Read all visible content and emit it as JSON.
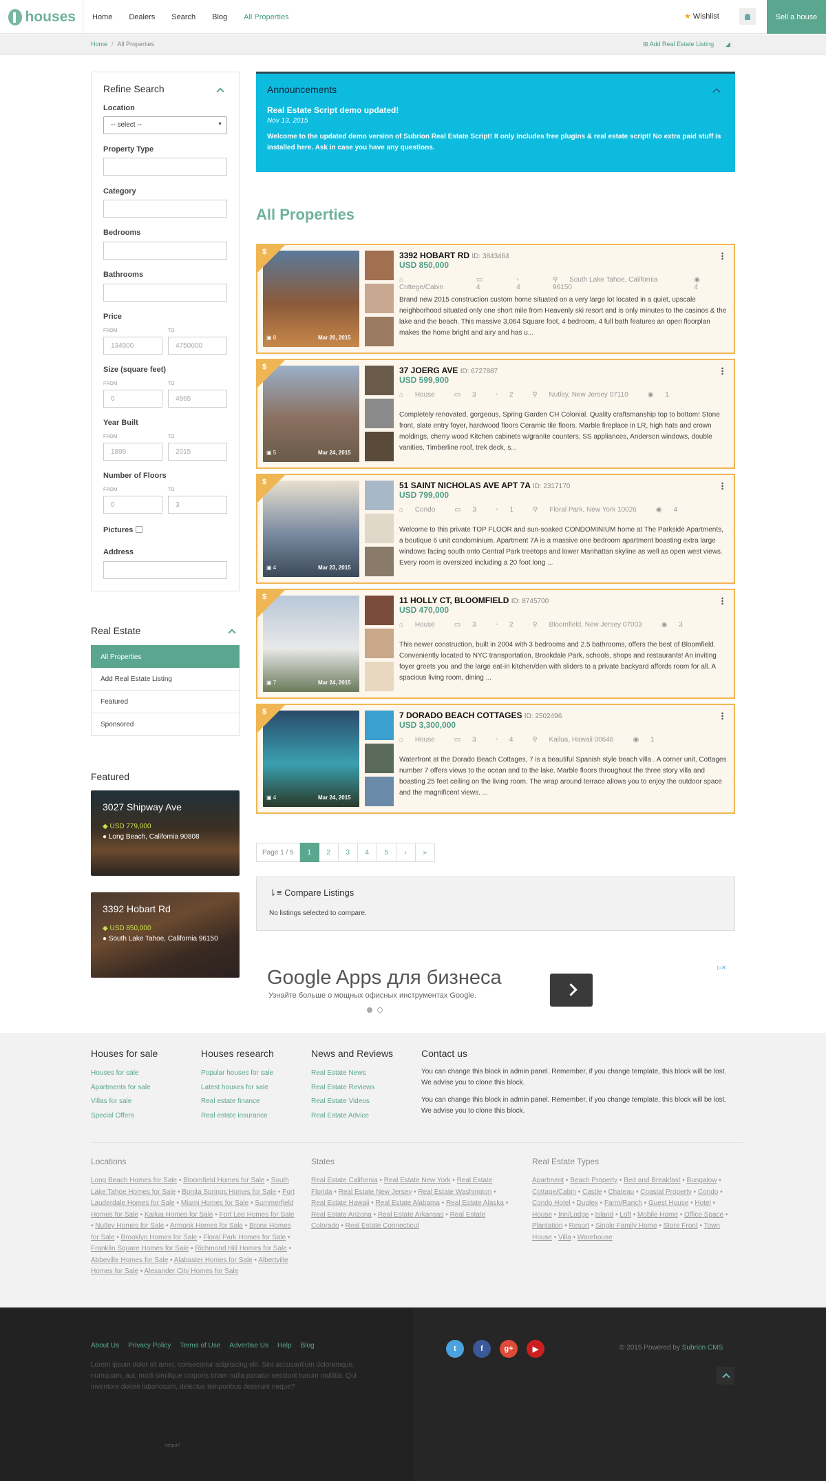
{
  "header": {
    "logo_text": "houses",
    "nav": [
      "Home",
      "Dealers",
      "Search",
      "Blog",
      "All Properties"
    ],
    "wishlist": "Wishlist",
    "sell": "Sell a house"
  },
  "breadcrumb": {
    "home": "Home",
    "sep": "/",
    "current": "All Properties",
    "add_listing": "Add Real Estate Listing"
  },
  "refine": {
    "title": "Refine Search",
    "location_label": "Location",
    "location_value": "-- select --",
    "property_type": "Property Type",
    "category": "Category",
    "bedrooms": "Bedrooms",
    "bathrooms": "Bathrooms",
    "from": "FROM",
    "to": "TO",
    "price": {
      "label": "Price",
      "from": "134900",
      "to": "4750000"
    },
    "size": {
      "label": "Size (square feet)",
      "from": "0",
      "to": "4865"
    },
    "year": {
      "label": "Year Built",
      "from": "1899",
      "to": "2015"
    },
    "floors": {
      "label": "Number of Floors",
      "from": "0",
      "to": "3"
    },
    "pictures": "Pictures",
    "address": "Address"
  },
  "real_estate": {
    "title": "Real Estate",
    "items": [
      "All Properties",
      "Add Real Estate Listing",
      "Featured",
      "Sponsored"
    ]
  },
  "featured": {
    "title": "Featured",
    "cards": [
      {
        "title": "3027 Shipway Ave",
        "price": "USD 779,000",
        "address": "Long Beach, California 90808"
      },
      {
        "title": "3392 Hobart Rd",
        "price": "USD 850,000",
        "address": "South Lake Tahoe, California 96150"
      }
    ]
  },
  "announcements": {
    "title": "Announcements",
    "subtitle": "Real Estate Script demo updated!",
    "date": "Nov 13, 2015",
    "body": "Welcome to the updated demo version of Subrion Real Estate Script! It only includes free plugins & real estate script! No extra paid stuff is installed here. Ask in case you have any questions."
  },
  "page_title": "All Properties",
  "listings": [
    {
      "title": "3392 HOBART RD",
      "id": "ID: 3843464",
      "price": "USD 850,000",
      "type": "Cottege/Cabin",
      "beds": "4",
      "baths": "4",
      "location": "South Lake Tahoe, California 96150",
      "views": "4",
      "photos": "8",
      "date": "Mar 20, 2015",
      "desc": "Brand new 2015 construction custom home situated on a very large lot located in a quiet, upscale neighborhood situated only one short mile from Heavenly ski resort and is only minutes to the casinos & the lake and the beach. This massive 3,064 Square foot, 4 bedroom, 4 full bath features an open floorplan makes the home bright and airy and has u..."
    },
    {
      "title": "37 JOERG AVE",
      "id": "ID: 6727887",
      "price": "USD 599,900",
      "type": "House",
      "beds": "3",
      "baths": "2",
      "location": "Nutley, New Jersey 07110",
      "views": "1",
      "photos": "5",
      "date": "Mar 24, 2015",
      "desc": "Completely renovated, gorgeous, Spring Garden CH Colonial. Quality craftsmanship top to bottom! Stone front, slate entry foyer, hardwood floors Ceramic tile floors. Marble fireplace in LR, high hats and crown moldings, cherry wood Kitchen cabinets w/granite counters, SS appliances, Anderson windows, double vanities, Timberline roof, trek deck, s..."
    },
    {
      "title": "51 SAINT NICHOLAS AVE APT 7A",
      "id": "ID: 2317170",
      "price": "USD 799,000",
      "type": "Condo",
      "beds": "3",
      "baths": "1",
      "location": "Floral Park, New York 10026",
      "views": "4",
      "photos": "4",
      "date": "Mar 23, 2015",
      "desc": "Welcome to this private TOP FLOOR and sun-soaked CONDOMINIUM home at The Parkside Apartments, a boutique 6 unit condominium. Apartment 7A is a massive one bedroom apartment boasting extra large windows facing south onto Central Park treetops and lower Manhattan skyline as well as open west views. Every room is oversized including a 20 foot long ..."
    },
    {
      "title": "11 HOLLY CT, BLOOMFIELD",
      "id": "ID: 8745700",
      "price": "USD 470,000",
      "type": "House",
      "beds": "3",
      "baths": "2",
      "location": "Bloomfield, New Jersey 07003",
      "views": "3",
      "photos": "7",
      "date": "Mar 24, 2015",
      "desc": "This newer construction, built in 2004 with 3 bedrooms and 2.5 bathrooms, offers the best of Bloomfield. Conveniently located to NYC transportation, Brookdale Park, schools, shops and restaurants! An inviting foyer greets you and the large eat-in kitchen/den with sliders to a private backyard affords room for all. A spacious living room, dining ..."
    },
    {
      "title": "7 DORADO BEACH COTTAGES",
      "id": "ID: 2502496",
      "price": "USD 3,300,000",
      "type": "House",
      "beds": "3",
      "baths": "4",
      "location": "Kailua, Hawaii 00646",
      "views": "1",
      "photos": "4",
      "date": "Mar 24, 2015",
      "desc": "Waterfront at the Dorado Beach Cottages, 7 is a beautiful Spanish style beach villa . A corner unit, Cottages number 7 offers views to the ocean and to the lake. Marble floors throughout the three story villa and boasting 25 feet ceiling on the living room. The wrap around terrace allows you to enjoy the outdoor space and the magnificent views. ..."
    }
  ],
  "pagination": {
    "info": "Page 1 / 5",
    "pages": [
      "1",
      "2",
      "3",
      "4",
      "5"
    ],
    "next": "›",
    "last": "»"
  },
  "compare": {
    "title": "Compare Listings",
    "text": "No listings selected to compare."
  },
  "ad": {
    "headline": "Google Apps для бизнеса",
    "sub": "Узнайте больше о мощных офисных инструментах Google."
  },
  "footer": {
    "col1": {
      "title": "Houses for sale",
      "links": [
        "Houses for sale",
        "Apartments for sale",
        "Villas for sale",
        "Special Offers"
      ]
    },
    "col2": {
      "title": "Houses research",
      "links": [
        "Popular houses for sale",
        "Latest houses for sale",
        "Real estate finance",
        "Real estate insurance"
      ]
    },
    "col3": {
      "title": "News and Reviews",
      "links": [
        "Real Estate News",
        "Real Estate Reviews",
        "Real Estate Videos",
        "Real Estate Advice"
      ]
    },
    "col4": {
      "title": "Contact us",
      "p1": "You can change this block in admin panel. Remember, if you change template, this block will be lost. We advise you to clone this block.",
      "p2": "You can change this block in admin panel. Remember, if you change template, this block will be lost. We advise you to clone this block."
    },
    "locations": {
      "title": "Locations",
      "links": [
        "Long Beach Homes for Sale",
        "Bloomfield Homes for Sale",
        "South Lake Tahoe Homes for Sale",
        "Bonita Springs Homes for Sale",
        "Fort Lauderdale Homes for Sale",
        "Miami Homes for Sale",
        "Summerfield Homes for Sale",
        "Kailua Homes for Sale",
        "Fort Lee Homes for Sale",
        "Nutley Homes for Sale",
        "Armonk Homes for Sale",
        "Bronx Homes for Sale",
        "Brooklyn Homes for Sale",
        "Floral Park Homes for Sale",
        "Franklin Square Homes for Sale",
        "Richmond Hill Homes for Sale",
        "Abbeville Homes for Sale",
        "Alabaster Homes for Sale",
        "Albertville Homes for Sale",
        "Alexander City Homes for Sale"
      ]
    },
    "states": {
      "title": "States",
      "links": [
        "Real Estate California",
        "Real Estate New York",
        "Real Estate Florida",
        "Real Estate New Jersey",
        "Real Estate Washington",
        "Real Estate Hawaii",
        "Real Estate Alabama",
        "Real Estate Alaska",
        "Real Estate Arizona",
        "Real Estate Arkansas",
        "Real Estate Colorado",
        "Real Estate Connecticut"
      ]
    },
    "types": {
      "title": "Real Estate Types",
      "links": [
        "Apartment",
        "Beach Property",
        "Bed and Breakfast",
        "Bungalow",
        "Cottage/Cabin",
        "Castle",
        "Chateau",
        "Coastal Property",
        "Condo",
        "Condo Hotel",
        "Duplex",
        "Farm/Ranch",
        "Guest House",
        "Hotel",
        "House",
        "Inn/Lodge",
        "Island",
        "Loft",
        "Mobile Home",
        "Office Space",
        "Plantation",
        "Resort",
        "Single Family Home",
        "Store Front",
        "Town House",
        "Villa",
        "Warehouse"
      ]
    },
    "bottom_nav": [
      "About Us",
      "Privacy Policy",
      "Terms of Use",
      "Advertise Us",
      "Help",
      "Blog"
    ],
    "lorem": "Lorem ipsum dolor sit amet, consectetur adipisicing elit. Sint accusantium doloremque, numquam, aut, modi similique corporis totam nulla pariatur nesciunt harum mollitia. Qui inventore dolore laboriosam, delectus temporibus deserunt neque?",
    "tiny": "neque!",
    "powered_prefix": "© 2015 Powered by",
    "powered_link": "Subrion CMS"
  }
}
